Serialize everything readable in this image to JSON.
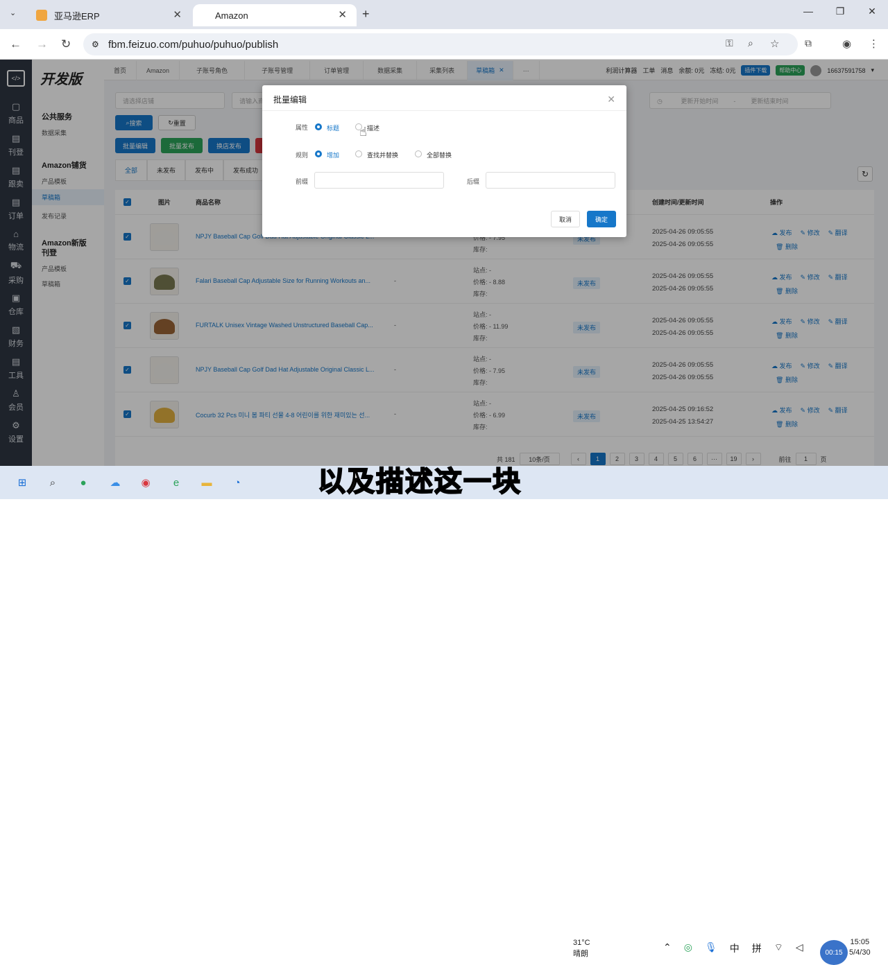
{
  "browser": {
    "tabs": [
      {
        "title": "亚马逊ERP"
      },
      {
        "title": "Amazon"
      }
    ],
    "url": "fbm.feizuo.com/puhuo/puhuo/publish"
  },
  "left_nav": [
    {
      "label": "商品"
    },
    {
      "label": "刊登"
    },
    {
      "label": "跟卖"
    },
    {
      "label": "订单"
    },
    {
      "label": "物流"
    },
    {
      "label": "采购"
    },
    {
      "label": "仓库"
    },
    {
      "label": "财务"
    },
    {
      "label": "工具"
    },
    {
      "label": "会员"
    },
    {
      "label": "设置"
    }
  ],
  "sub_nav": {
    "brand": "开发版",
    "group1": "公共服务",
    "g1_items": [
      "数据采集"
    ],
    "group2": "Amazon铺货",
    "g2_items": [
      "产品模板",
      "草稿箱",
      "发布记录"
    ],
    "group3": "Amazon新版刊登",
    "g3_items": [
      "产品模板",
      "草稿箱"
    ]
  },
  "top_tabs": [
    "首页",
    "Amazon",
    "子账号角色",
    "子账号管理",
    "订单管理",
    "数据采集",
    "采集列表",
    "草稿箱",
    "···"
  ],
  "top_right": {
    "calc": "利润计算器",
    "ticket": "工单",
    "msg": "消息",
    "balance": "余额: 0元",
    "frozen": "冻结: 0元",
    "plugin": "插件下载",
    "help": "帮助中心",
    "user": "16637591758"
  },
  "filters": {
    "store": "请选择店铺",
    "input": "请输入商",
    "start": "更新开始时间",
    "end": "更新结束时间",
    "search": "搜索",
    "reset": "重置"
  },
  "actions": {
    "batch_edit": "批量编辑",
    "batch_publish": "批量发布",
    "switch_store": "换店发布"
  },
  "status_tabs": [
    "全部",
    "未发布",
    "发布中",
    "发布成功"
  ],
  "table": {
    "headers": {
      "img": "图片",
      "name": "商品名称",
      "time": "创建时间/更新时间",
      "ops": "操作"
    },
    "rows": [
      {
        "name": "NPJY Baseball Cap Golf Dad Hat Adjustable Original Classic L...",
        "site": "站点: -",
        "price": "价格: - 7.95",
        "stock": "库存:",
        "status": "未发布",
        "created": "2025-04-26 09:05:55",
        "updated": "2025-04-26 09:05:55"
      },
      {
        "name": "Falari Baseball Cap Adjustable Size for Running Workouts an...",
        "site": "站点: -",
        "price": "价格: - 8.88",
        "stock": "库存:",
        "status": "未发布",
        "created": "2025-04-26 09:05:55",
        "updated": "2025-04-26 09:05:55"
      },
      {
        "name": "FURTALK Unisex Vintage Washed Unstructured Baseball Cap...",
        "site": "站点: -",
        "price": "价格: - 11.99",
        "stock": "库存:",
        "status": "未发布",
        "created": "2025-04-26 09:05:55",
        "updated": "2025-04-26 09:05:55"
      },
      {
        "name": "NPJY Baseball Cap Golf Dad Hat Adjustable Original Classic L...",
        "site": "站点: -",
        "price": "价格: - 7.95",
        "stock": "库存:",
        "status": "未发布",
        "created": "2025-04-26 09:05:55",
        "updated": "2025-04-26 09:05:55"
      },
      {
        "name": "Cocurb 32 Pcs 미니 봄 파티 선물 4-8 어린이를 위한 재미있는 선...",
        "site": "站点: -",
        "price": "价格: - 6.99",
        "stock": "库存:",
        "status": "未发布",
        "created": "2025-04-25 09:16:52",
        "updated": "2025-04-25 13:54:27"
      }
    ],
    "dash": "-",
    "op_publish": "发布",
    "op_edit": "修改",
    "op_translate": "翻译",
    "op_delete": "删除"
  },
  "pager": {
    "total": "共 181",
    "per_page": "10条/页",
    "pages": [
      "1",
      "2",
      "3",
      "4",
      "5",
      "6",
      "···",
      "19"
    ],
    "goto": "前往",
    "goto_val": "1",
    "page_suffix": "页"
  },
  "modal": {
    "title": "批量编辑",
    "attr_label": "属性",
    "attr_opt1": "标题",
    "attr_opt2": "描述",
    "rule_label": "规则",
    "rule_opt1": "增加",
    "rule_opt2": "查找并替换",
    "rule_opt3": "全部替换",
    "prefix": "前缀",
    "suffix": "后缀",
    "cancel": "取消",
    "confirm": "确定"
  },
  "taskbar": {
    "weather_temp": "31°C",
    "weather_desc": "晴朗",
    "ime1": "中",
    "ime2": "拼",
    "time": "15:05",
    "date": "5/4/30",
    "rec_time": "00:15"
  },
  "subtitle": {
    "main": "以及描述这",
    "highlight": "一块"
  }
}
